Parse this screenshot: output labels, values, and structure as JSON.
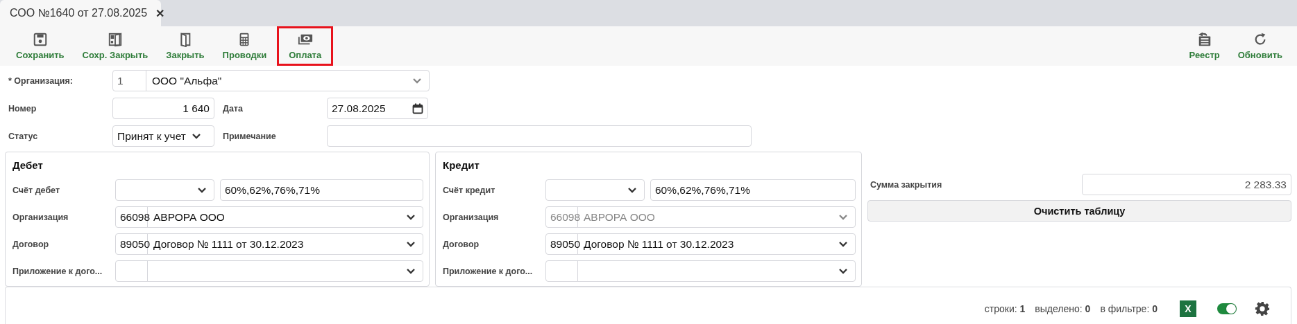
{
  "tab": {
    "title": "СОО №1640 от 27.08.2025",
    "selected": true,
    "close": "✕"
  },
  "toolbar": {
    "left": [
      {
        "label": "Сохранить",
        "highlighted": false
      },
      {
        "label": "Сохр. Закрыть",
        "highlighted": false
      },
      {
        "label": "Закрыть",
        "highlighted": false
      },
      {
        "label": "Проводки",
        "highlighted": false
      },
      {
        "label": "Оплата",
        "highlighted": true
      }
    ],
    "right": [
      {
        "label": "Реестр",
        "highlighted": false
      },
      {
        "label": "Обновить",
        "highlighted": false
      }
    ]
  },
  "form": {
    "organization": {
      "label": "* Организация:",
      "code": "1",
      "name": "ООО \"Альфа\""
    },
    "number": {
      "label": "Номер",
      "value": "1 640"
    },
    "date": {
      "label": "Дата",
      "value": "27.08.2025"
    },
    "status": {
      "label": "Статус",
      "value": "Принят к учет"
    },
    "note": {
      "label": "Примечание"
    }
  },
  "panels": [
    {
      "title": "Дебет",
      "rows": [
        {
          "kind": "account",
          "label": "Счёт дебет",
          "mask": "60%,62%,76%,71%"
        },
        {
          "kind": "lookup",
          "label": "Организация",
          "code": "66098",
          "name": "АВРОРА ООО",
          "disabled": false
        },
        {
          "kind": "lookup",
          "label": "Договор",
          "code": "89050",
          "name": "Договор № 1111 от 30.12.2023",
          "disabled": false
        },
        {
          "kind": "lookup",
          "label": "Приложение к дого...",
          "disabled": false
        }
      ]
    },
    {
      "title": "Кредит",
      "rows": [
        {
          "kind": "account",
          "label": "Счёт кредит",
          "mask": "60%,62%,76%,71%"
        },
        {
          "kind": "lookup",
          "label": "Организация",
          "code": "66098",
          "name": "АВРОРА ООО",
          "disabled": true
        },
        {
          "kind": "lookup",
          "label": "Договор",
          "code": "89050",
          "name": "Договор № 1111 от 30.12.2023",
          "disabled": false
        },
        {
          "kind": "lookup",
          "label": "Приложение к дого...",
          "disabled": false
        }
      ]
    }
  ],
  "summary": {
    "label": "Сумма закрытия",
    "value": "2 283.33",
    "button": "Очистить таблицу"
  },
  "footer": {
    "stats": [
      {
        "label": "строки:",
        "value": "1"
      },
      {
        "label": "выделено:",
        "value": "0"
      },
      {
        "label": "в фильтре:",
        "value": "0"
      }
    ],
    "excel": "X",
    "toggle": {
      "on": true
    }
  }
}
